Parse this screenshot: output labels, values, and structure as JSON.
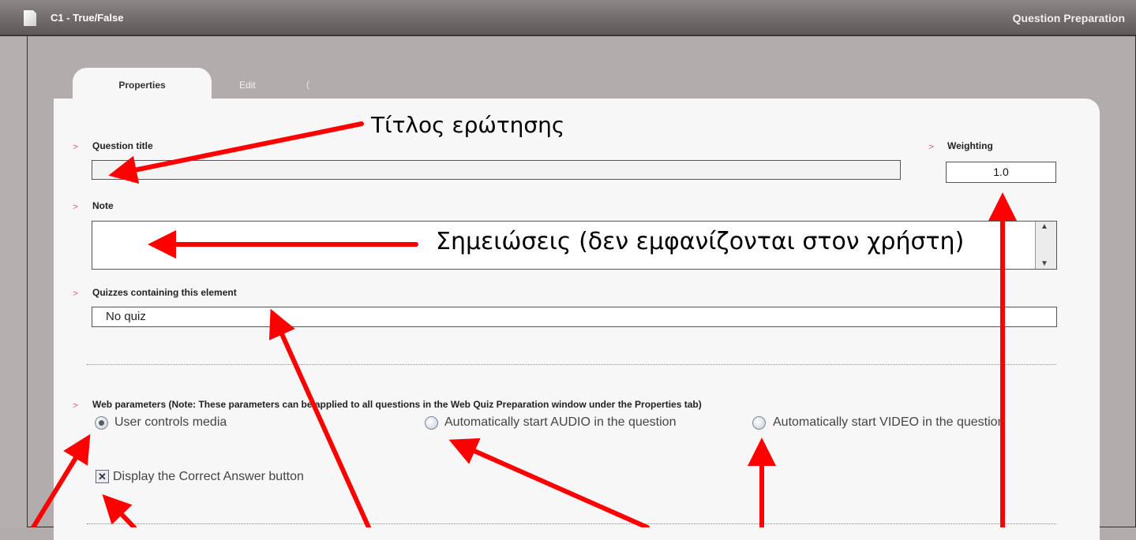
{
  "window": {
    "title": "C1 - True/False",
    "section": "Question Preparation",
    "icon": "document-icon"
  },
  "tabs": [
    {
      "label": "Properties",
      "active": true
    },
    {
      "label": "Edit",
      "active": false
    },
    {
      "label": "(",
      "active": false
    }
  ],
  "form": {
    "bullet": ":>",
    "question_title": {
      "label": "Question title",
      "value": ""
    },
    "weighting": {
      "label": "Weighting",
      "value": "1.0"
    },
    "note": {
      "label": "Note",
      "value": ""
    },
    "quizzes": {
      "label": "Quizzes containing this element",
      "value": "No quiz"
    },
    "web_parameters": {
      "label": "Web parameters (Note: These parameters can be applied to all questions in the Web Quiz Preparation window under the Properties tab)",
      "options": [
        {
          "label": "User controls media",
          "selected": true
        },
        {
          "label": "Automatically start AUDIO in the question",
          "selected": false
        },
        {
          "label": "Automatically start VIDEO in the question",
          "selected": false
        }
      ],
      "checkbox": {
        "label": "Display the Correct Answer button",
        "checked": true
      }
    }
  },
  "annotations": {
    "title_note": "Τίτλος ερώτησης",
    "note_note": "Σημειώσεις (δεν εμφανίζονται στον χρήστη)",
    "arrow_color": "#ff0000"
  }
}
